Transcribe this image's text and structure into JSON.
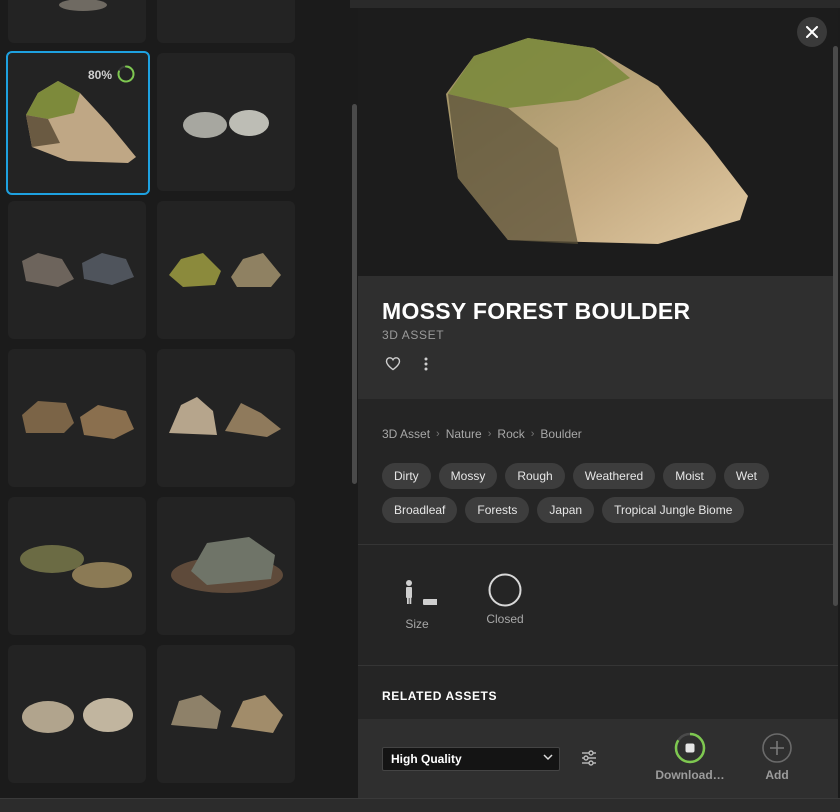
{
  "progress": {
    "label": "80%",
    "value": 0.8
  },
  "asset": {
    "title": "MOSSY FOREST BOULDER",
    "type": "3D ASSET"
  },
  "breadcrumb": [
    "3D Asset",
    "Nature",
    "Rock",
    "Boulder"
  ],
  "tags": [
    "Dirty",
    "Mossy",
    "Rough",
    "Weathered",
    "Moist",
    "Wet",
    "Broadleaf",
    "Forests",
    "Japan",
    "Tropical Jungle Biome"
  ],
  "attributes": {
    "size_label": "Size",
    "closed_label": "Closed"
  },
  "related_label": "RELATED ASSETS",
  "footer": {
    "quality_value": "High Quality",
    "download_label": "Download…",
    "add_label": "Add"
  },
  "icons": [
    "close-icon",
    "heart-icon",
    "more-icon",
    "chevron-right-icon",
    "person-size-icon",
    "circle-closed-icon",
    "chevron-down-icon",
    "sliders-icon",
    "download-progress-icon",
    "add-circle-icon"
  ],
  "colors": {
    "accent": "#1ea1e0",
    "progress": "#7ec850",
    "panel": "#252525",
    "info": "#2f2f2f"
  }
}
